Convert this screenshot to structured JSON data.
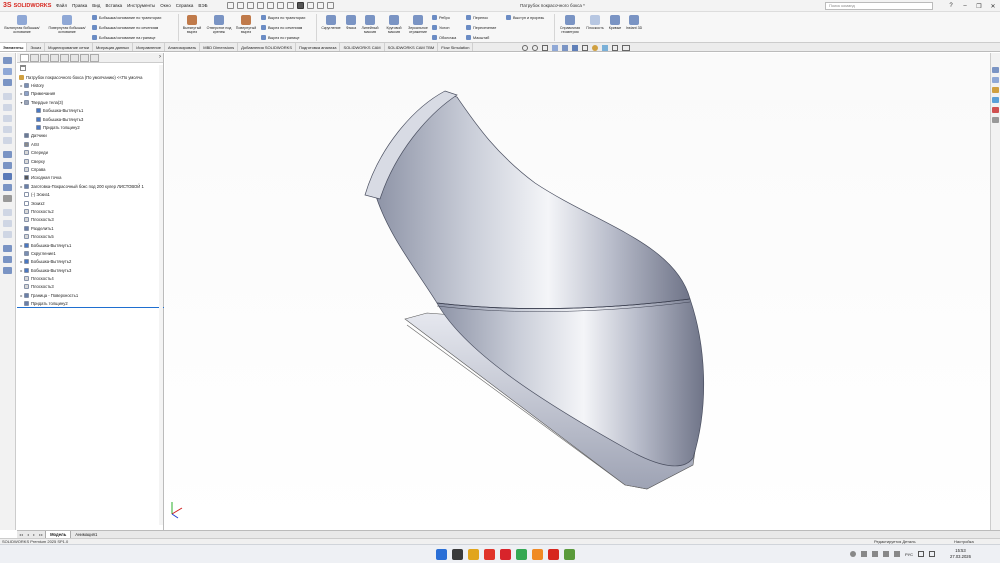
{
  "app": {
    "logo_mark": "3S",
    "logo_name": "SOLIDWORKS",
    "document_title": "Патрубок покрасочного бокса *",
    "search_placeholder": "Поиск команд"
  },
  "menu": [
    "Файл",
    "Правка",
    "Вид",
    "Вставка",
    "Инструменты",
    "Окно",
    "Справка",
    "ВЭБ"
  ],
  "ribbon": {
    "extrude_boss": "Вытянутая бобышка/основание",
    "revolve_boss": "Повернутая бобышка/основание",
    "sweep_boss": "Бобышка/основание по траектории",
    "loft_boss": "Бобышка/основание по сечениям",
    "boundary_boss": "Бобышка/основание на границе",
    "extrude_cut": "Вытянутый вырез",
    "hole_wizard": "Отверстие под крепеж",
    "revolve_cut": "Повернутый вырез",
    "sweep_cut": "Вырез по траектории",
    "loft_cut": "Вырез по сечениям",
    "boundary_cut": "Вырез по границе",
    "fillet": "Скругление",
    "chamfer": "Фаска",
    "linear_pattern": "Линейный массив",
    "circular_pattern": "Круговой массив",
    "mirror": "Зеркальное отражение",
    "rib": "Ребро",
    "draft": "Уклон",
    "shell": "Оболочка",
    "wrap": "Перенос",
    "intersect": "Пересечение",
    "scale": "Масштаб",
    "boss_cut": "Выступ и прорезь",
    "ref_geometry": "Справочная геометрия",
    "plane": "Плоскость",
    "curves": "Кривые",
    "instant3d": "Instant 3D"
  },
  "command_tabs": [
    "Элементы",
    "Эскиз",
    "Моделирование сетки",
    "Миграция данных",
    "Исправление",
    "Анализировать",
    "MBD Dimensions",
    "Добавления SOLIDWORKS",
    "Подготовка анализа",
    "SOLIDWORKS CAM",
    "SOLIDWORKS CAM TBM",
    "Flow Simulation"
  ],
  "tree": {
    "root": "Патрубок покрасочного бокса (По умолчанию) <<По умолча",
    "items": [
      {
        "label": "History",
        "expand": "▸",
        "color": "#7a8fb3"
      },
      {
        "label": "Примечания",
        "expand": "▸",
        "color": "#8fa3c8"
      },
      {
        "label": "Твердые тела(3)",
        "expand": "▾",
        "color": "#9aa3b5"
      },
      {
        "label": "Бобышка-Вытянуть1",
        "expand": "",
        "color": "#4a78c2",
        "indent": 1
      },
      {
        "label": "Бобышка-Вытянуть3",
        "expand": "",
        "color": "#4a78c2",
        "indent": 1
      },
      {
        "label": "Придать толщину2",
        "expand": "",
        "color": "#4a78c2",
        "indent": 1
      },
      {
        "label": "Датчики",
        "expand": "",
        "color": "#6b7a94"
      },
      {
        "label": "AISI",
        "expand": "",
        "color": "#8a8a8a"
      },
      {
        "label": "Спереди",
        "expand": "",
        "color": "#d8d8d8"
      },
      {
        "label": "Сверху",
        "expand": "",
        "color": "#d8d8d8"
      },
      {
        "label": "Справа",
        "expand": "",
        "color": "#d8d8d8"
      },
      {
        "label": "Исходная точка",
        "expand": "",
        "color": "#555555"
      },
      {
        "label": "Заготовка-Покрасочный бокс под 200 кулер ЛИСТОВОЙ 1",
        "expand": "▸",
        "color": "#6a7fa8"
      },
      {
        "label": "(-) Эскиз1",
        "expand": "",
        "color": "#ffffff"
      },
      {
        "label": "Эскиз2",
        "expand": "",
        "color": "#ffffff"
      },
      {
        "label": "Плоскость2",
        "expand": "",
        "color": "#d8d8d8"
      },
      {
        "label": "Плоскость3",
        "expand": "",
        "color": "#d8d8d8"
      },
      {
        "label": "Разделить1",
        "expand": "",
        "color": "#6a7fa8"
      },
      {
        "label": "Плоскость5",
        "expand": "",
        "color": "#d8d8d8"
      },
      {
        "label": "Бобышка-Вытянуть1",
        "expand": "▸",
        "color": "#4a78c2"
      },
      {
        "label": "Скругление1",
        "expand": "",
        "color": "#7a8fb3"
      },
      {
        "label": "Бобышка-Вытянуть2",
        "expand": "▸",
        "color": "#4a78c2"
      },
      {
        "label": "Бобышка-Вытянуть3",
        "expand": "▸",
        "color": "#4a78c2"
      },
      {
        "label": "Плоскость4",
        "expand": "",
        "color": "#d8d8d8"
      },
      {
        "label": "Плоскость3",
        "expand": "",
        "color": "#d8d8d8"
      },
      {
        "label": "Граница - Поверхность1",
        "expand": "▸",
        "color": "#6a7fa8"
      },
      {
        "label": "Придать толщину2",
        "expand": "",
        "color": "#6a7fa8",
        "selected": true
      }
    ]
  },
  "bottom_tabs": [
    "Модель",
    "Анимация1"
  ],
  "status": {
    "version": "SOLIDWORKS Premium 2025 SP1.0",
    "editing": "Редактируется Деталь",
    "config": "Настройка"
  },
  "taskbar": {
    "lang": "РУС",
    "time": "15:53",
    "date": "27.03.2026",
    "icons": [
      {
        "name": "windows-start-icon",
        "color": "#2a6fd6"
      },
      {
        "name": "search-app-icon",
        "color": "#3a3a3a"
      },
      {
        "name": "explorer-icon",
        "color": "#e1a51c"
      },
      {
        "name": "yandex-icon",
        "color": "#e0342a"
      },
      {
        "name": "opera-icon",
        "color": "#d8242b"
      },
      {
        "name": "chrome-icon",
        "color": "#34a853"
      },
      {
        "name": "mail-icon",
        "color": "#f08a24"
      },
      {
        "name": "solidworks-task-icon",
        "color": "#d7261e"
      },
      {
        "name": "app-icon",
        "color": "#5a9a3a"
      }
    ]
  },
  "colors": {
    "accent": "#d7261e",
    "selection": "#1f6fd0",
    "model_fill": "#b5bac9"
  }
}
